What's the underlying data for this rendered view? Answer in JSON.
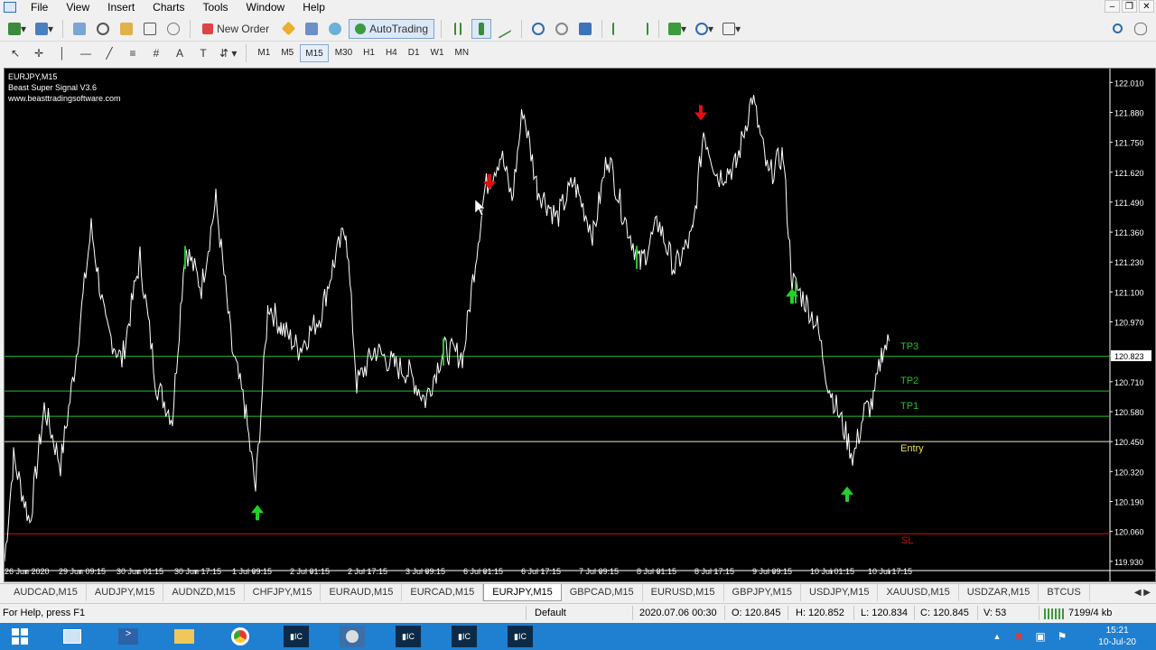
{
  "menu": {
    "file": "File",
    "view": "View",
    "insert": "Insert",
    "charts": "Charts",
    "tools": "Tools",
    "window": "Window",
    "help": "Help"
  },
  "toolbar": {
    "new_order": "New Order",
    "autotrading": "AutoTrading"
  },
  "timeframes": [
    "M1",
    "M5",
    "M15",
    "M30",
    "H1",
    "H4",
    "D1",
    "W1",
    "MN"
  ],
  "active_timeframe": "M15",
  "chart": {
    "symbol_line": "EURJPY,M15",
    "indicator_name": "Beast Super Signal V3.6",
    "indicator_url": "www.beasttradingsoftware.com",
    "current_price": "120.823",
    "levels": [
      {
        "name": "TP3",
        "price": 120.82,
        "color": "#22c22a"
      },
      {
        "name": "TP2",
        "price": 120.67,
        "color": "#22c22a"
      },
      {
        "name": "TP1",
        "price": 120.56,
        "color": "#22c22a"
      },
      {
        "name": "Entry",
        "price": 120.45,
        "color": "#e8e8c8"
      },
      {
        "name": "SL",
        "price": 120.05,
        "color": "#c0141a"
      }
    ],
    "price_axis": [
      "122.010",
      "121.880",
      "121.750",
      "121.620",
      "121.490",
      "121.360",
      "121.230",
      "121.100",
      "120.970",
      "120.823",
      "120.710",
      "120.580",
      "120.450",
      "120.320",
      "120.190",
      "120.060",
      "119.930"
    ],
    "time_axis": [
      "26 Jun 2020",
      "29 Jun 09:15",
      "30 Jun 01:15",
      "30 Jun 17:15",
      "1 Jul 09:15",
      "2 Jul 01:15",
      "2 Jul 17:15",
      "3 Jul 09:15",
      "6 Jul 01:15",
      "6 Jul 17:15",
      "7 Jul 09:15",
      "8 Jul 01:15",
      "8 Jul 17:15",
      "9 Jul 09:15",
      "10 Jul 01:15",
      "10 Jul 17:15"
    ]
  },
  "tabs": [
    "AUDCAD,M15",
    "AUDJPY,M15",
    "AUDNZD,M15",
    "CHFJPY,M15",
    "EURAUD,M15",
    "EURCAD,M15",
    "EURJPY,M15",
    "GBPCAD,M15",
    "EURUSD,M15",
    "GBPJPY,M15",
    "USDJPY,M15",
    "XAUUSD,M15",
    "USDZAR,M15",
    "BTCUS"
  ],
  "active_tab": "EURJPY,M15",
  "status": {
    "help": "For Help, press F1",
    "profile": "Default",
    "datetime": "2020.07.06 00:30",
    "open": "O: 120.845",
    "high": "H: 120.852",
    "low": "L: 120.834",
    "close": "C: 120.845",
    "volume": "V: 53",
    "traffic": "7199/4 kb"
  },
  "taskbar": {
    "time": "15:21",
    "date": "10-Jul-20"
  }
}
